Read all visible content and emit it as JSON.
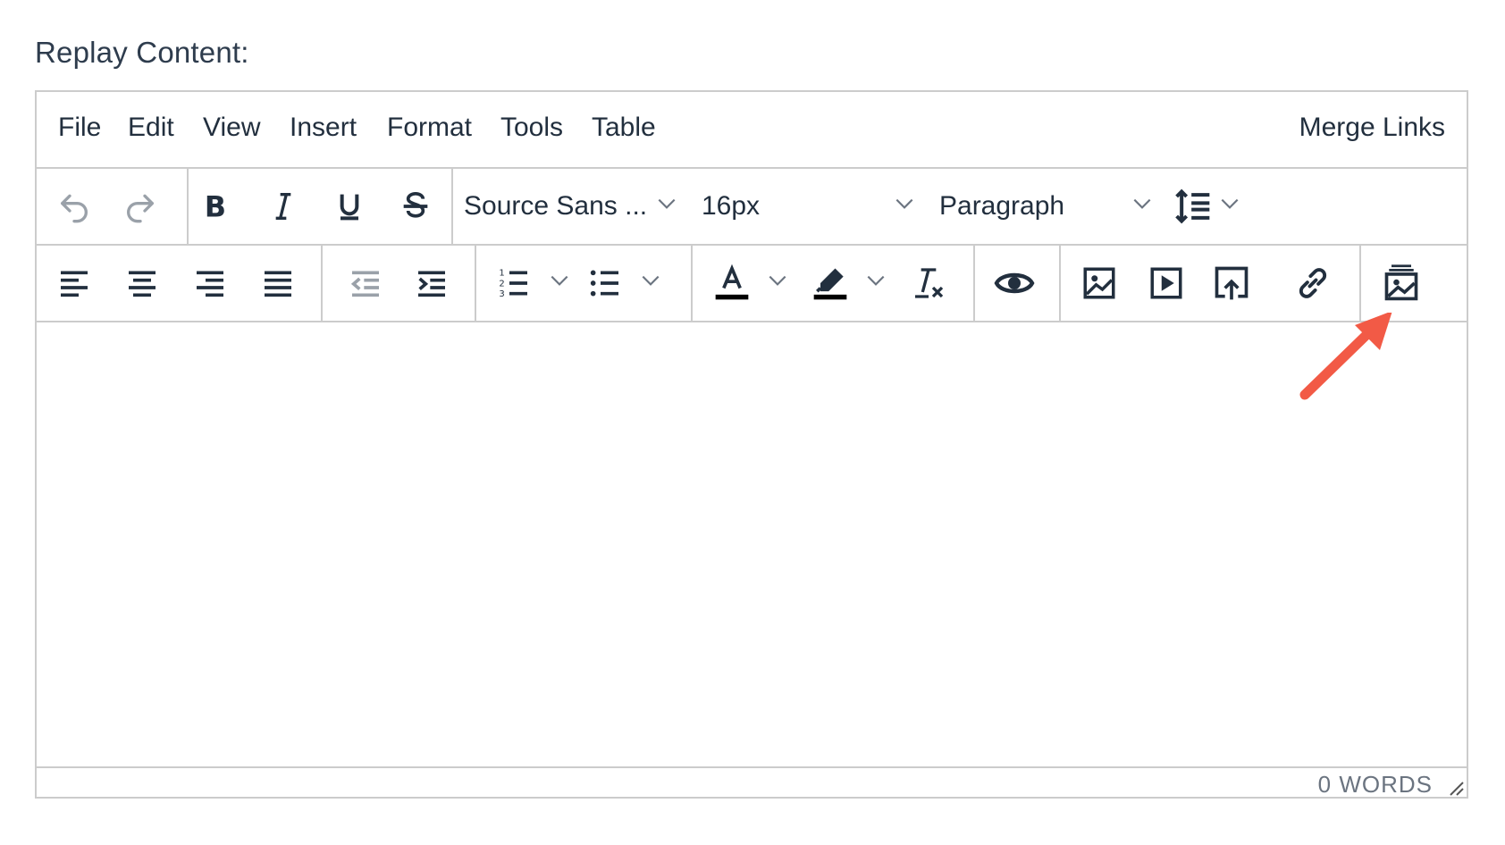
{
  "field": {
    "label": "Replay Content:"
  },
  "menubar": {
    "items": [
      "File",
      "Edit",
      "View",
      "Insert",
      "Format",
      "Tools",
      "Table"
    ],
    "right_item": "Merge Links"
  },
  "toolbar": {
    "font_family": "Source Sans ...",
    "font_size": "16px",
    "block_format": "Paragraph",
    "row1_icons": [
      "undo-icon",
      "redo-icon",
      "bold-icon",
      "italic-icon",
      "underline-icon",
      "strikethrough-icon",
      "line-height-icon"
    ],
    "row2_icons": [
      "align-left-icon",
      "align-center-icon",
      "align-right-icon",
      "align-justify-icon",
      "outdent-icon",
      "indent-icon",
      "numbered-list-icon",
      "bullet-list-icon",
      "text-color-icon",
      "highlight-color-icon",
      "clear-formatting-icon",
      "preview-icon",
      "image-icon",
      "media-icon",
      "upload-icon",
      "link-icon",
      "image-gallery-icon"
    ]
  },
  "statusbar": {
    "word_count": "0 WORDS"
  },
  "colors": {
    "icon": "#222f3e",
    "border": "#cccccc",
    "label": "#2e3c4d",
    "annotation_arrow": "#f25a46",
    "disabled_icon": "#9aa1a9"
  }
}
